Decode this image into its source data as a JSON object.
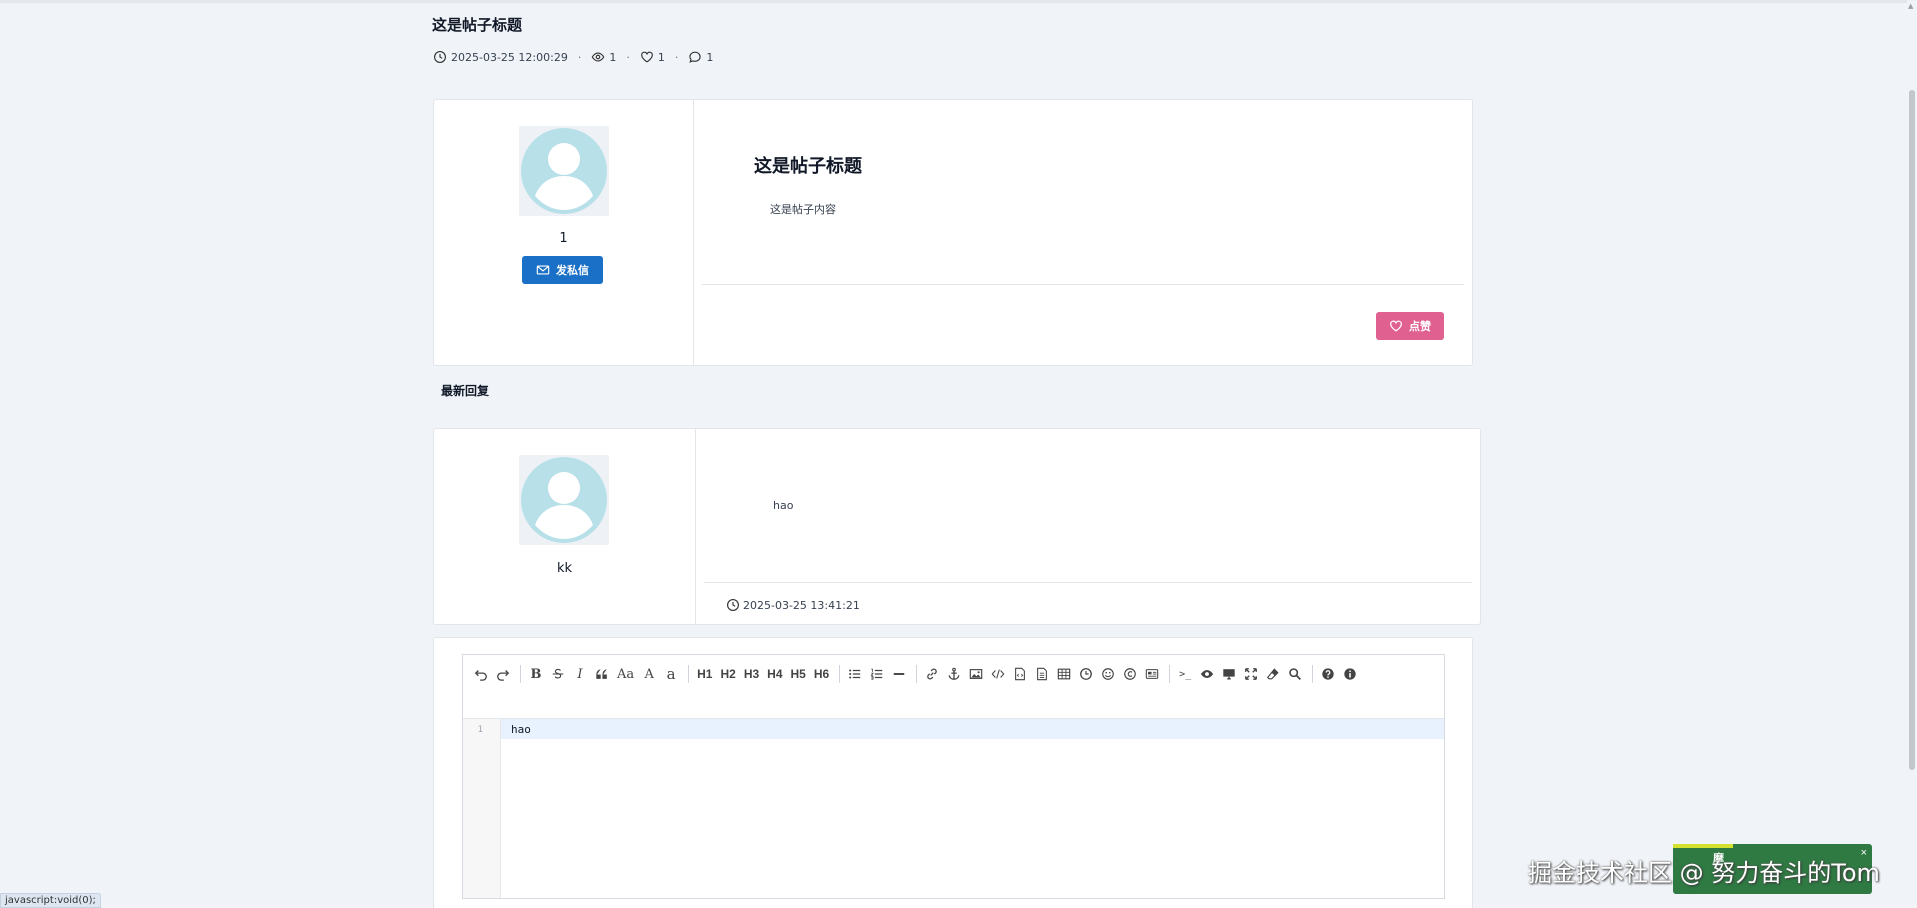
{
  "page": {
    "title": "这是帖子标题",
    "meta": {
      "datetime": "2025-03-25 12:00:29",
      "views": "1",
      "likes": "1",
      "comments": "1"
    }
  },
  "post": {
    "author": "1",
    "message_button": "发私信",
    "heading": "这是帖子标题",
    "content": "这是帖子内容",
    "like_button": "点赞"
  },
  "replies_section": {
    "title": "最新回复"
  },
  "replies": [
    {
      "author": "kk",
      "content": "hao",
      "datetime": "2025-03-25 13:41:21"
    }
  ],
  "editor": {
    "toolbar_row1": [
      "H1",
      "H2",
      "H3",
      "H4",
      "H5",
      "H6"
    ],
    "text_tools": {
      "aa": "Aa",
      "a_upper": "A",
      "a_lower": "a",
      "bold": "B",
      "italic": "I",
      "terminal": ">_"
    },
    "line_number": "1",
    "value": "hao"
  },
  "status_bar": {
    "url": "javascript:void(0);"
  },
  "overlay": {
    "watermark": "掘金技术社区 @ 努力奋斗的Tom",
    "widget_label": "摩",
    "widget_close": "×"
  },
  "colors": {
    "primary": "#1a6fc7",
    "like": "#e0608f",
    "background": "#f0f3f7",
    "avatar": "#b8e0e8"
  }
}
